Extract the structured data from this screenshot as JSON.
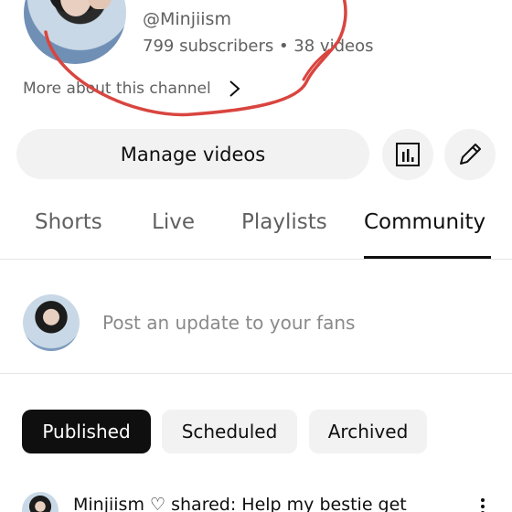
{
  "channel": {
    "handle": "@Minjiism",
    "stats": "799 subscribers • 38 videos",
    "more_about": "More about this channel"
  },
  "actions": {
    "manage_videos": "Manage videos",
    "analytics_icon": "bar-chart-icon",
    "edit_icon": "pencil-icon"
  },
  "tabs": [
    {
      "label": "Shorts",
      "active": false
    },
    {
      "label": "Live",
      "active": false
    },
    {
      "label": "Playlists",
      "active": false
    },
    {
      "label": "Community",
      "active": true
    }
  ],
  "composer": {
    "placeholder": "Post an update to your fans"
  },
  "filters": [
    {
      "label": "Published",
      "active": true
    },
    {
      "label": "Scheduled",
      "active": false
    },
    {
      "label": "Archived",
      "active": false
    }
  ],
  "post": {
    "author": "Minjiism",
    "heart": "♡",
    "action": "shared:",
    "text": "Help my bestie get"
  },
  "colors": {
    "annotation": "#d9453f",
    "chip_active": "#0f0f0f",
    "chip_inactive": "#f2f2f2"
  }
}
